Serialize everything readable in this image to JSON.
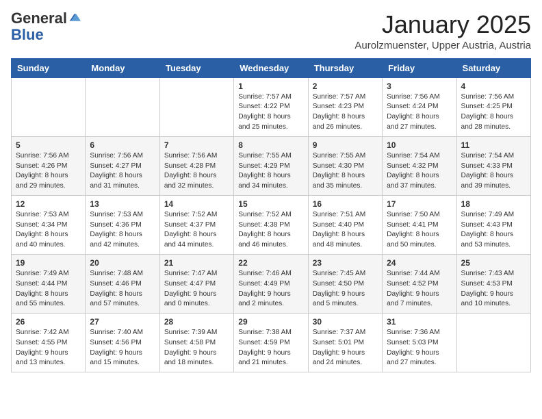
{
  "logo": {
    "general": "General",
    "blue": "Blue"
  },
  "title": {
    "month": "January 2025",
    "location": "Aurolzmuenster, Upper Austria, Austria"
  },
  "weekdays": [
    "Sunday",
    "Monday",
    "Tuesday",
    "Wednesday",
    "Thursday",
    "Friday",
    "Saturday"
  ],
  "weeks": [
    [
      {
        "day": "",
        "info": ""
      },
      {
        "day": "",
        "info": ""
      },
      {
        "day": "",
        "info": ""
      },
      {
        "day": "1",
        "info": "Sunrise: 7:57 AM\nSunset: 4:22 PM\nDaylight: 8 hours and 25 minutes."
      },
      {
        "day": "2",
        "info": "Sunrise: 7:57 AM\nSunset: 4:23 PM\nDaylight: 8 hours and 26 minutes."
      },
      {
        "day": "3",
        "info": "Sunrise: 7:56 AM\nSunset: 4:24 PM\nDaylight: 8 hours and 27 minutes."
      },
      {
        "day": "4",
        "info": "Sunrise: 7:56 AM\nSunset: 4:25 PM\nDaylight: 8 hours and 28 minutes."
      }
    ],
    [
      {
        "day": "5",
        "info": "Sunrise: 7:56 AM\nSunset: 4:26 PM\nDaylight: 8 hours and 29 minutes."
      },
      {
        "day": "6",
        "info": "Sunrise: 7:56 AM\nSunset: 4:27 PM\nDaylight: 8 hours and 31 minutes."
      },
      {
        "day": "7",
        "info": "Sunrise: 7:56 AM\nSunset: 4:28 PM\nDaylight: 8 hours and 32 minutes."
      },
      {
        "day": "8",
        "info": "Sunrise: 7:55 AM\nSunset: 4:29 PM\nDaylight: 8 hours and 34 minutes."
      },
      {
        "day": "9",
        "info": "Sunrise: 7:55 AM\nSunset: 4:30 PM\nDaylight: 8 hours and 35 minutes."
      },
      {
        "day": "10",
        "info": "Sunrise: 7:54 AM\nSunset: 4:32 PM\nDaylight: 8 hours and 37 minutes."
      },
      {
        "day": "11",
        "info": "Sunrise: 7:54 AM\nSunset: 4:33 PM\nDaylight: 8 hours and 39 minutes."
      }
    ],
    [
      {
        "day": "12",
        "info": "Sunrise: 7:53 AM\nSunset: 4:34 PM\nDaylight: 8 hours and 40 minutes."
      },
      {
        "day": "13",
        "info": "Sunrise: 7:53 AM\nSunset: 4:36 PM\nDaylight: 8 hours and 42 minutes."
      },
      {
        "day": "14",
        "info": "Sunrise: 7:52 AM\nSunset: 4:37 PM\nDaylight: 8 hours and 44 minutes."
      },
      {
        "day": "15",
        "info": "Sunrise: 7:52 AM\nSunset: 4:38 PM\nDaylight: 8 hours and 46 minutes."
      },
      {
        "day": "16",
        "info": "Sunrise: 7:51 AM\nSunset: 4:40 PM\nDaylight: 8 hours and 48 minutes."
      },
      {
        "day": "17",
        "info": "Sunrise: 7:50 AM\nSunset: 4:41 PM\nDaylight: 8 hours and 50 minutes."
      },
      {
        "day": "18",
        "info": "Sunrise: 7:49 AM\nSunset: 4:43 PM\nDaylight: 8 hours and 53 minutes."
      }
    ],
    [
      {
        "day": "19",
        "info": "Sunrise: 7:49 AM\nSunset: 4:44 PM\nDaylight: 8 hours and 55 minutes."
      },
      {
        "day": "20",
        "info": "Sunrise: 7:48 AM\nSunset: 4:46 PM\nDaylight: 8 hours and 57 minutes."
      },
      {
        "day": "21",
        "info": "Sunrise: 7:47 AM\nSunset: 4:47 PM\nDaylight: 9 hours and 0 minutes."
      },
      {
        "day": "22",
        "info": "Sunrise: 7:46 AM\nSunset: 4:49 PM\nDaylight: 9 hours and 2 minutes."
      },
      {
        "day": "23",
        "info": "Sunrise: 7:45 AM\nSunset: 4:50 PM\nDaylight: 9 hours and 5 minutes."
      },
      {
        "day": "24",
        "info": "Sunrise: 7:44 AM\nSunset: 4:52 PM\nDaylight: 9 hours and 7 minutes."
      },
      {
        "day": "25",
        "info": "Sunrise: 7:43 AM\nSunset: 4:53 PM\nDaylight: 9 hours and 10 minutes."
      }
    ],
    [
      {
        "day": "26",
        "info": "Sunrise: 7:42 AM\nSunset: 4:55 PM\nDaylight: 9 hours and 13 minutes."
      },
      {
        "day": "27",
        "info": "Sunrise: 7:40 AM\nSunset: 4:56 PM\nDaylight: 9 hours and 15 minutes."
      },
      {
        "day": "28",
        "info": "Sunrise: 7:39 AM\nSunset: 4:58 PM\nDaylight: 9 hours and 18 minutes."
      },
      {
        "day": "29",
        "info": "Sunrise: 7:38 AM\nSunset: 4:59 PM\nDaylight: 9 hours and 21 minutes."
      },
      {
        "day": "30",
        "info": "Sunrise: 7:37 AM\nSunset: 5:01 PM\nDaylight: 9 hours and 24 minutes."
      },
      {
        "day": "31",
        "info": "Sunrise: 7:36 AM\nSunset: 5:03 PM\nDaylight: 9 hours and 27 minutes."
      },
      {
        "day": "",
        "info": ""
      }
    ]
  ]
}
